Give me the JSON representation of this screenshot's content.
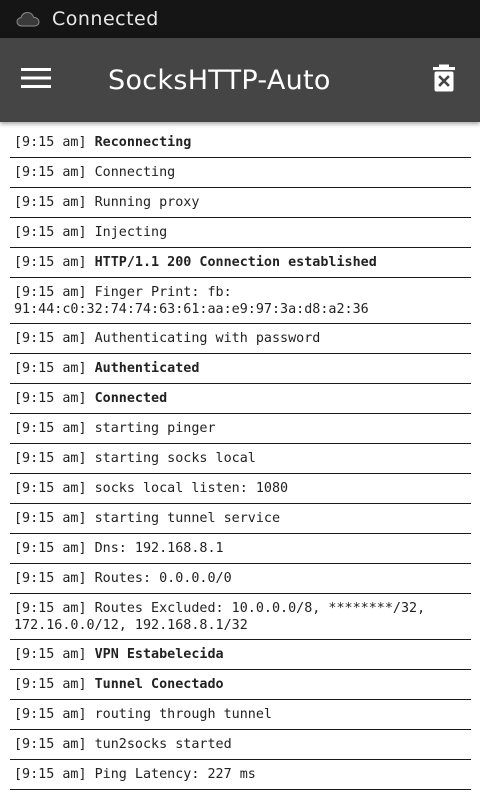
{
  "status_bar": {
    "icon": "cloud-icon",
    "text": "Connected"
  },
  "toolbar": {
    "title": "SocksHTTP-Auto",
    "menu_icon": "hamburger-menu-icon",
    "delete_icon": "trash-clear-icon"
  },
  "colors": {
    "status_bar_bg": "#151515",
    "toolbar_bg": "#454545",
    "log_text": "#222222",
    "divider": "#1a1a1a"
  },
  "logs": [
    {
      "time": "[9:15 am]",
      "message": "Reconnecting",
      "bold": true
    },
    {
      "time": "[9:15 am]",
      "message": "Connecting",
      "bold": false
    },
    {
      "time": "[9:15 am]",
      "message": "Running proxy",
      "bold": false
    },
    {
      "time": "[9:15 am]",
      "message": "Injecting",
      "bold": false
    },
    {
      "time": "[9:15 am]",
      "message": "HTTP/1.1 200 Connection established",
      "bold": true
    },
    {
      "time": "[9:15 am]",
      "message": "Finger Print: fb:\n91:44:c0:32:74:74:63:61:aa:e9:97:3a:d8:a2:36",
      "bold": false
    },
    {
      "time": "[9:15 am]",
      "message": "Authenticating with password",
      "bold": false
    },
    {
      "time": "[9:15 am]",
      "message": "Authenticated",
      "bold": true
    },
    {
      "time": "[9:15 am]",
      "message": "Connected",
      "bold": true
    },
    {
      "time": "[9:15 am]",
      "message": "starting pinger",
      "bold": false
    },
    {
      "time": "[9:15 am]",
      "message": "starting socks local",
      "bold": false
    },
    {
      "time": "[9:15 am]",
      "message": "socks local listen: 1080",
      "bold": false
    },
    {
      "time": "[9:15 am]",
      "message": "starting tunnel service",
      "bold": false
    },
    {
      "time": "[9:15 am]",
      "message": "Dns: 192.168.8.1",
      "bold": false
    },
    {
      "time": "[9:15 am]",
      "message": "Routes: 0.0.0.0/0",
      "bold": false
    },
    {
      "time": "[9:15 am]",
      "message": "Routes Excluded: 10.0.0.0/8, ********/32,\n172.16.0.0/12, 192.168.8.1/32",
      "bold": false
    },
    {
      "time": "[9:15 am]",
      "message": "VPN Estabelecida",
      "bold": true
    },
    {
      "time": "[9:15 am]",
      "message": "Tunnel Conectado",
      "bold": true
    },
    {
      "time": "[9:15 am]",
      "message": "routing through tunnel",
      "bold": false
    },
    {
      "time": "[9:15 am]",
      "message": "tun2socks started",
      "bold": false
    },
    {
      "time": "[9:15 am]",
      "message": "Ping Latency: 227 ms",
      "bold": false
    }
  ]
}
